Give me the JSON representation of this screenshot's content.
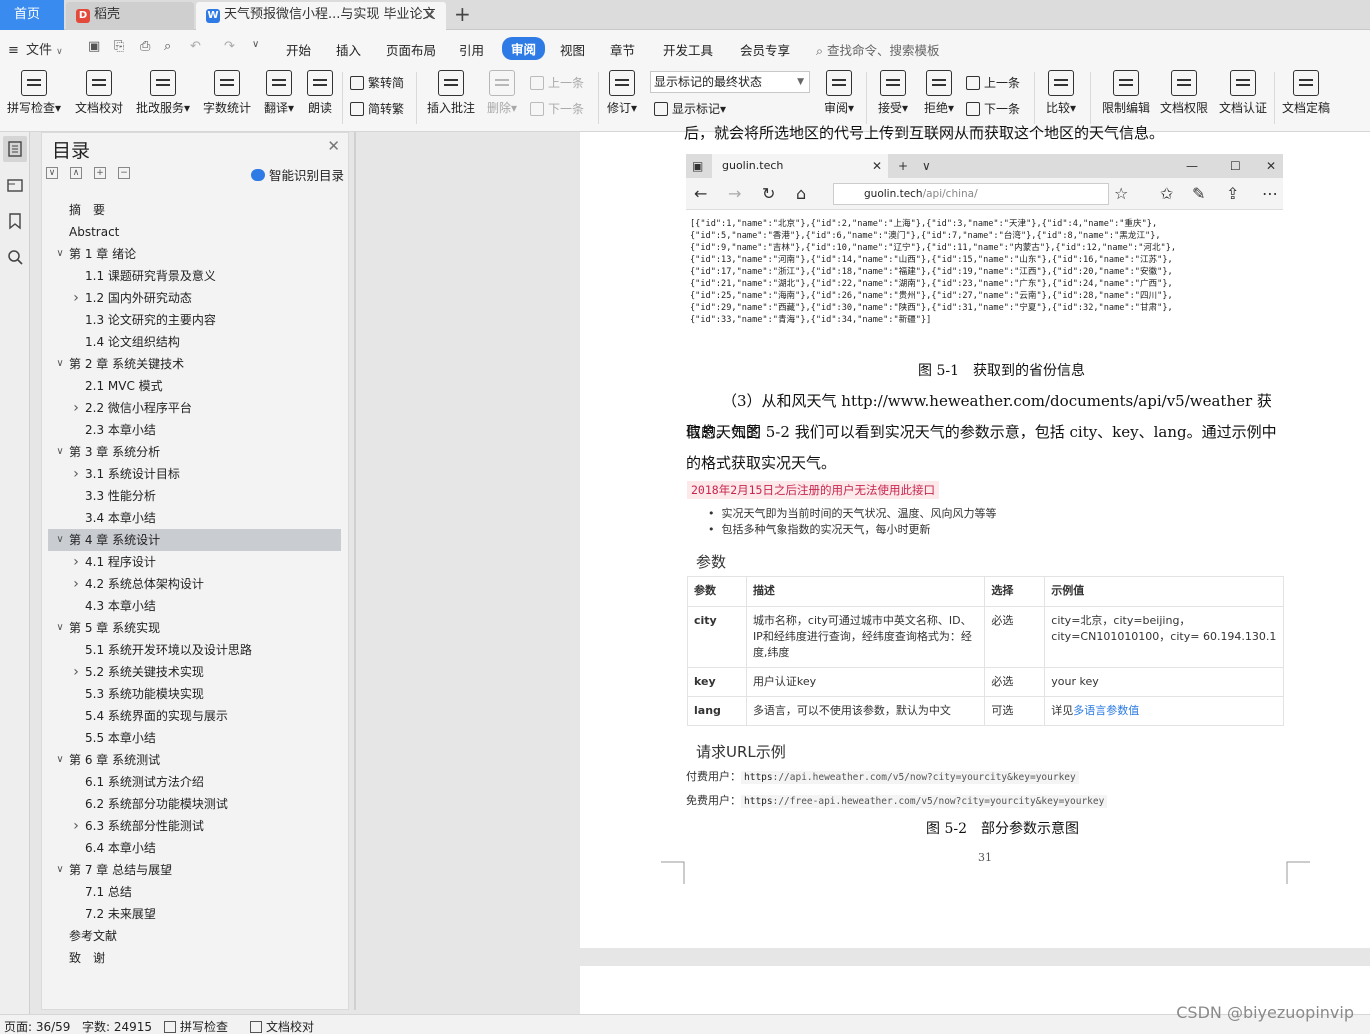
{
  "tabs": {
    "home": "首页",
    "daoke": "稻壳",
    "doc_title": "天气预报微信小程...与实现 毕业论文"
  },
  "menu": {
    "file": "文件",
    "items": [
      "开始",
      "插入",
      "页面布局",
      "引用",
      "审阅",
      "视图",
      "章节",
      "开发工具",
      "会员专享"
    ],
    "active": "审阅",
    "search_placeholder": "查找命令、搜索模板"
  },
  "ribbon": {
    "spell_check": "拼写检查",
    "doc_proof": "文档校对",
    "batch_service": "批改服务",
    "word_count": "字数统计",
    "translate": "翻译",
    "read_aloud": "朗读",
    "trad_to_simp": "繁转简",
    "simp_to_trad": "简转繁",
    "insert_comment": "插入批注",
    "delete": "删除",
    "prev": "上一条",
    "next": "下一条",
    "revise": "修订",
    "markup_select": "显示标记的最终状态",
    "show_markup": "显示标记",
    "review": "审阅",
    "accept": "接受",
    "reject": "拒绝",
    "prev2": "上一条",
    "next2": "下一条",
    "compare": "比较",
    "restrict_edit": "限制编辑",
    "doc_permission": "文档权限",
    "doc_auth": "文档认证",
    "doc_finalize": "文档定稿"
  },
  "toc": {
    "title": "目录",
    "smart": "智能识别目录",
    "items": [
      {
        "text": "摘　要",
        "level": 1,
        "arrow": ""
      },
      {
        "text": "Abstract",
        "level": 1,
        "arrow": ""
      },
      {
        "text": "第 1 章  绪论",
        "level": 1,
        "arrow": "down"
      },
      {
        "text": "1.1 课题研究背景及意义",
        "level": 2,
        "arrow": ""
      },
      {
        "text": "1.2 国内外研究动态",
        "level": 2,
        "arrow": "right"
      },
      {
        "text": "1.3 论文研究的主要内容",
        "level": 2,
        "arrow": ""
      },
      {
        "text": "1.4 论文组织结构",
        "level": 2,
        "arrow": ""
      },
      {
        "text": "第 2 章  系统关键技术",
        "level": 1,
        "arrow": "down"
      },
      {
        "text": "2.1 MVC 模式",
        "level": 2,
        "arrow": ""
      },
      {
        "text": "2.2  微信小程序平台",
        "level": 2,
        "arrow": "right"
      },
      {
        "text": "2.3 本章小结",
        "level": 2,
        "arrow": ""
      },
      {
        "text": "第 3 章  系统分析",
        "level": 1,
        "arrow": "down"
      },
      {
        "text": "3.1 系统设计目标",
        "level": 2,
        "arrow": "right"
      },
      {
        "text": "3.3 性能分析",
        "level": 2,
        "arrow": ""
      },
      {
        "text": "3.4 本章小结",
        "level": 2,
        "arrow": ""
      },
      {
        "text": "第 4 章  系统设计",
        "level": 1,
        "arrow": "down",
        "selected": true
      },
      {
        "text": "4.1 程序设计",
        "level": 2,
        "arrow": "right"
      },
      {
        "text": "4.2 系统总体架构设计",
        "level": 2,
        "arrow": "right"
      },
      {
        "text": "4.3 本章小结",
        "level": 2,
        "arrow": ""
      },
      {
        "text": "第 5 章  系统实现",
        "level": 1,
        "arrow": "down"
      },
      {
        "text": "5.1 系统开发环境以及设计思路",
        "level": 2,
        "arrow": ""
      },
      {
        "text": "5.2 系统关键技术实现",
        "level": 2,
        "arrow": "right"
      },
      {
        "text": "5.3 系统功能模块实现",
        "level": 2,
        "arrow": ""
      },
      {
        "text": "5.4 系统界面的实现与展示",
        "level": 2,
        "arrow": ""
      },
      {
        "text": "5.5 本章小结",
        "level": 2,
        "arrow": ""
      },
      {
        "text": "第 6 章  系统测试",
        "level": 1,
        "arrow": "down"
      },
      {
        "text": "6.1 系统测试方法介绍",
        "level": 2,
        "arrow": ""
      },
      {
        "text": "6.2 系统部分功能模块测试",
        "level": 2,
        "arrow": ""
      },
      {
        "text": "6.3 系统部分性能测试",
        "level": 2,
        "arrow": "right"
      },
      {
        "text": "6.4 本章小结",
        "level": 2,
        "arrow": ""
      },
      {
        "text": "第 7 章  总结与展望",
        "level": 1,
        "arrow": "down"
      },
      {
        "text": "7.1 总结",
        "level": 2,
        "arrow": ""
      },
      {
        "text": "7.2 未来展望",
        "level": 2,
        "arrow": ""
      },
      {
        "text": "参考文献",
        "level": 1,
        "arrow": ""
      },
      {
        "text": "致　谢",
        "level": 1,
        "arrow": ""
      }
    ]
  },
  "doc": {
    "cut_line": "后，就会将所选地区的代号上传到互联网从而获取这个地区的天气信息。",
    "browser": {
      "tab": "guolin.tech",
      "address_host": "guolin.tech",
      "address_path": "/api/china/",
      "json_lines": [
        "[{\"id\":1,\"name\":\"北京\"},{\"id\":2,\"name\":\"上海\"},{\"id\":3,\"name\":\"天津\"},{\"id\":4,\"name\":\"重庆\"},",
        "{\"id\":5,\"name\":\"香港\"},{\"id\":6,\"name\":\"澳门\"},{\"id\":7,\"name\":\"台湾\"},{\"id\":8,\"name\":\"黑龙江\"},",
        "{\"id\":9,\"name\":\"吉林\"},{\"id\":10,\"name\":\"辽宁\"},{\"id\":11,\"name\":\"内蒙古\"},{\"id\":12,\"name\":\"河北\"},",
        "{\"id\":13,\"name\":\"河南\"},{\"id\":14,\"name\":\"山西\"},{\"id\":15,\"name\":\"山东\"},{\"id\":16,\"name\":\"江苏\"},",
        "{\"id\":17,\"name\":\"浙江\"},{\"id\":18,\"name\":\"福建\"},{\"id\":19,\"name\":\"江西\"},{\"id\":20,\"name\":\"安徽\"},",
        "{\"id\":21,\"name\":\"湖北\"},{\"id\":22,\"name\":\"湖南\"},{\"id\":23,\"name\":\"广东\"},{\"id\":24,\"name\":\"广西\"},",
        "{\"id\":25,\"name\":\"海南\"},{\"id\":26,\"name\":\"贵州\"},{\"id\":27,\"name\":\"云南\"},{\"id\":28,\"name\":\"四川\"},",
        "{\"id\":29,\"name\":\"西藏\"},{\"id\":30,\"name\":\"陕西\"},{\"id\":31,\"name\":\"宁夏\"},{\"id\":32,\"name\":\"甘肃\"},",
        "{\"id\":33,\"name\":\"青海\"},{\"id\":34,\"name\":\"新疆\"}]"
      ]
    },
    "fig1_caption": "图 5-1　获取到的省份信息",
    "para_line1": "（3）从和风天气 http://www.heweather.com/documents/api/v5/weather 获取的天气的",
    "para_line2": "信息。如图 5-2 我们可以看到实况天气的参数示意，包括 city、key、lang。通过示例中",
    "para_line3": "的格式获取实况天气。",
    "warning": "2018年2月15日之后注册的用户无法使用此接口",
    "bullets": [
      "实况天气即为当前时间的天气状况、温度、风向风力等等",
      "包括多种气象指数的实况天气，每小时更新"
    ],
    "params_heading": "参数",
    "table": {
      "headers": [
        "参数",
        "描述",
        "选择",
        "示例值"
      ],
      "rows": [
        {
          "param": "city",
          "desc": "城市名称，city可通过城市中英文名称、ID、IP和经纬度进行查询，经纬度查询格式为：经度,纬度",
          "choice": "必选",
          "example": "city=北京，city=beijing，city=CN101010100，city= 60.194.130.1",
          "link": ""
        },
        {
          "param": "key",
          "desc": "用户认证key",
          "choice": "必选",
          "example": "your key",
          "link": ""
        },
        {
          "param": "lang",
          "desc": "多语言，可以不使用该参数，默认为中文",
          "choice": "可选",
          "example": "详见",
          "link": "多语言参数值"
        }
      ]
    },
    "url_heading": "请求URL示例",
    "paid_label": "付费用户：",
    "paid_proto": "https",
    "paid_url": "://api.heweather.com/v5/now?city=yourcity&key=yourkey",
    "free_label": "免费用户：",
    "free_proto": "https",
    "free_url": "://free-api.heweather.com/v5/now?city=yourcity&key=yourkey",
    "fig2_caption": "图 5-2　部分参数示意图",
    "page_number": "31"
  },
  "status": {
    "page": "页面: 36/59",
    "words": "字数: 24915",
    "spell": "拼写检查",
    "proof": "文档校对"
  },
  "watermark": "CSDN @biyezuopinvip"
}
